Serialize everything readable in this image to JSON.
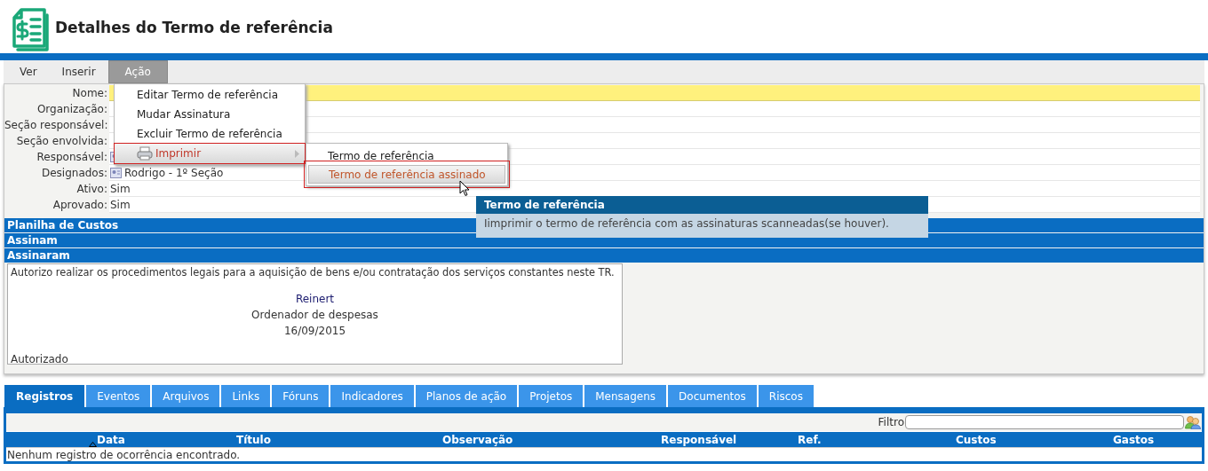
{
  "header": {
    "title": "Detalhes do Termo de referência"
  },
  "menubar": [
    {
      "label": "Ver",
      "selected": false
    },
    {
      "label": "Inserir",
      "selected": false
    },
    {
      "label": "Ação",
      "selected": true
    }
  ],
  "action_menu": {
    "items": [
      {
        "label": "Editar Termo de referência",
        "kind": "item",
        "highlighted": false
      },
      {
        "label": "Mudar Assinatura",
        "kind": "item",
        "highlighted": false
      },
      {
        "label": "Excluir Termo de referência",
        "kind": "item",
        "highlighted": false
      },
      {
        "label": "Imprimir",
        "kind": "submenu",
        "highlighted": true
      }
    ],
    "submenu": [
      {
        "label": "Termo de referência",
        "highlighted": false
      },
      {
        "label": "Termo de referência assinado",
        "highlighted": true
      }
    ]
  },
  "tooltip": {
    "title": "Termo de referência",
    "text": "Iimprimir o termo de referência com as assinaturas scanneadas(se houver)."
  },
  "details": [
    {
      "label": "Nome:",
      "kind": "text",
      "highlighted": true
    },
    {
      "label": "Organização:",
      "kind": "text",
      "highlighted": false
    },
    {
      "label": "Seção responsável:",
      "kind": "text",
      "highlighted": false
    },
    {
      "label": "Seção envolvida:",
      "kind": "text",
      "highlighted": false
    },
    {
      "label": "Responsável:",
      "kind": "person",
      "highlighted": false
    },
    {
      "label": "Designados:",
      "kind": "person",
      "value": "Rodrigo - 1º Seção",
      "highlighted": false
    },
    {
      "label": "Ativo:",
      "kind": "text",
      "value": "Sim",
      "highlighted": false
    },
    {
      "label": "Aprovado:",
      "kind": "text",
      "value": "Sim",
      "highlighted": false
    }
  ],
  "sections": [
    "Planilha de Custos",
    "Assinam",
    "Assinaram"
  ],
  "signature": {
    "statement": "Autorizo realizar os procedimentos legais para a aquisição de bens e/ou contratação dos serviços constantes neste TR.",
    "signer": "Reinert",
    "role": "Ordenador de despesas",
    "date": "16/09/2015",
    "status": "Autorizado"
  },
  "tabs": [
    {
      "label": "Registros",
      "selected": true
    },
    {
      "label": "Eventos",
      "selected": false
    },
    {
      "label": "Arquivos",
      "selected": false
    },
    {
      "label": "Links",
      "selected": false
    },
    {
      "label": "Fóruns",
      "selected": false
    },
    {
      "label": "Indicadores",
      "selected": false
    },
    {
      "label": "Planos de ação",
      "selected": false
    },
    {
      "label": "Projetos",
      "selected": false
    },
    {
      "label": "Mensagens",
      "selected": false
    },
    {
      "label": "Documentos",
      "selected": false
    },
    {
      "label": "Riscos",
      "selected": false
    }
  ],
  "filter": {
    "label": "Filtro"
  },
  "table": {
    "columns": [
      {
        "label": "Data",
        "sorted": true
      },
      {
        "label": "Título",
        "sorted": false
      },
      {
        "label": "Observação",
        "sorted": false
      },
      {
        "label": "Responsável",
        "sorted": false
      },
      {
        "label": "Ref.",
        "sorted": false
      },
      {
        "label": "Custos",
        "sorted": false
      },
      {
        "label": "Gastos",
        "sorted": false
      }
    ],
    "empty_message": "Nenhum registro de ocorrência encontrado."
  }
}
